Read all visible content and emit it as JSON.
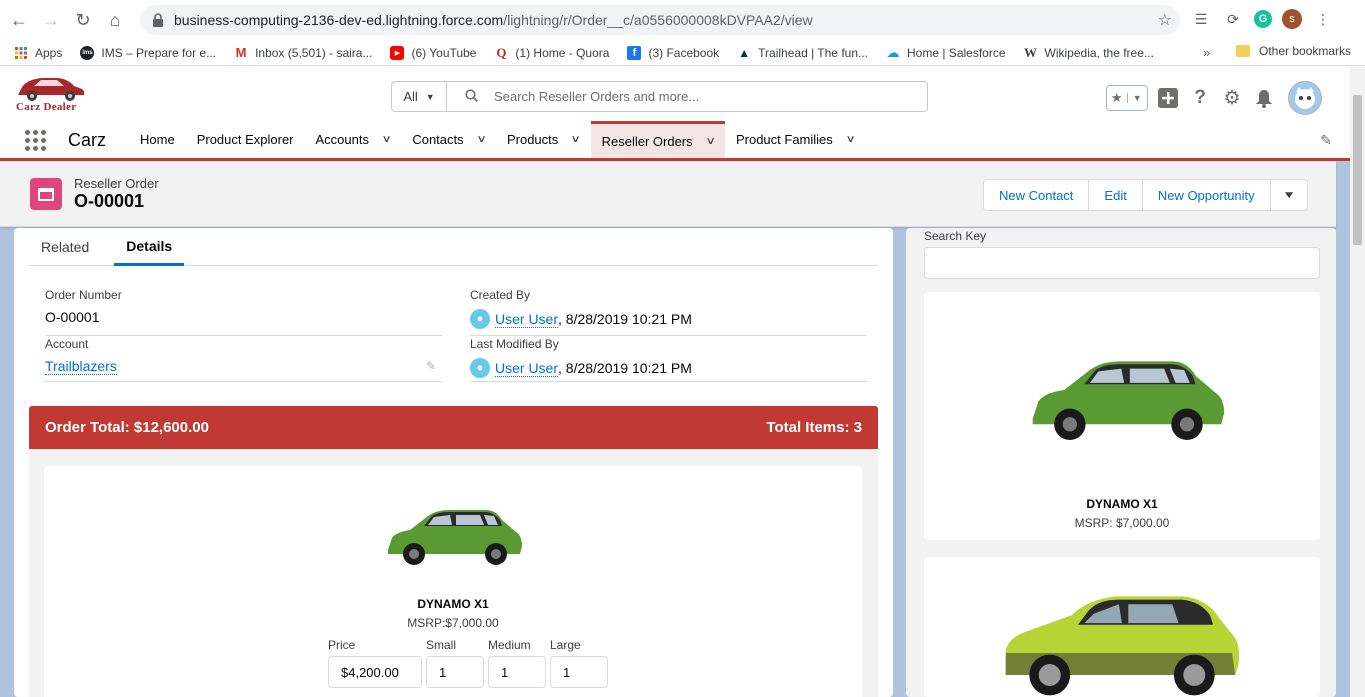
{
  "browser": {
    "url_host": "business-computing-2136-dev-ed.lightning.force.com",
    "url_path": "/lightning/r/Order__c/a0556000008kDVPAA2/view",
    "profile_initial": "s"
  },
  "bookmarks": {
    "items": [
      {
        "label": "Apps",
        "icon": "apps-grid-icon",
        "color": "#ea4335"
      },
      {
        "label": "IMS – Prepare for e...",
        "icon": "ims-icon",
        "color": "#202124"
      },
      {
        "label": "Inbox (5,501) - saira...",
        "icon": "gmail-icon",
        "color": "#d93025"
      },
      {
        "label": "(6) YouTube",
        "icon": "youtube-icon",
        "color": "#ff0000"
      },
      {
        "label": "(1) Home - Quora",
        "icon": "quora-icon",
        "color": "#b92b27"
      },
      {
        "label": "(3) Facebook",
        "icon": "facebook-icon",
        "color": "#1877f2"
      },
      {
        "label": "Trailhead | The fun...",
        "icon": "trailhead-icon",
        "color": "#032e61"
      },
      {
        "label": "Home | Salesforce",
        "icon": "salesforce-icon",
        "color": "#00a1e0"
      },
      {
        "label": "Wikipedia, the free...",
        "icon": "wikipedia-icon",
        "color": "#202124"
      }
    ],
    "more": "»",
    "other": "Other bookmarks"
  },
  "header": {
    "logo_text": "Carz Dealer",
    "search_scope": "All",
    "search_placeholder": "Search Reseller Orders and more..."
  },
  "app_nav": {
    "app_name": "Carz",
    "items": [
      {
        "label": "Home",
        "has_menu": false
      },
      {
        "label": "Product Explorer",
        "has_menu": false
      },
      {
        "label": "Accounts",
        "has_menu": true
      },
      {
        "label": "Contacts",
        "has_menu": true
      },
      {
        "label": "Products",
        "has_menu": true
      },
      {
        "label": "Reseller Orders",
        "has_menu": true,
        "active": true
      },
      {
        "label": "Product Families",
        "has_menu": true
      }
    ]
  },
  "record": {
    "type_label": "Reseller Order",
    "name": "O-00001",
    "actions": [
      "New Contact",
      "Edit",
      "New Opportunity"
    ]
  },
  "tabs": [
    {
      "label": "Related",
      "active": false
    },
    {
      "label": "Details",
      "active": true
    }
  ],
  "fields": {
    "order_number": {
      "label": "Order Number",
      "value": "O-00001"
    },
    "created_by": {
      "label": "Created By",
      "user": "User User",
      "date": ", 8/28/2019 10:21 PM"
    },
    "account": {
      "label": "Account",
      "value": "Trailblazers"
    },
    "last_modified_by": {
      "label": "Last Modified By",
      "user": "User User",
      "date": ", 8/28/2019 10:21 PM"
    }
  },
  "order": {
    "total": "Order Total: $12,600.00",
    "items": "Total Items: 3",
    "product": {
      "name": "DYNAMO X1",
      "msrp": "MSRP:$7,000.00",
      "price_label": "Price",
      "price_value": "$4,200.00",
      "small_label": "Small",
      "small_value": "1",
      "medium_label": "Medium",
      "medium_value": "1",
      "large_label": "Large",
      "large_value": "1"
    }
  },
  "sidebar": {
    "search_label": "Search Key",
    "tiles": [
      {
        "name": "DYNAMO X1",
        "msrp": "MSRP: $7,000.00",
        "color": "#5a9a32"
      },
      {
        "name": "",
        "msrp": "",
        "color": "#b8d334"
      }
    ]
  },
  "colors": {
    "brand_red": "#c23934",
    "link_blue": "#0070d2",
    "record_icon": "#e0457b"
  }
}
